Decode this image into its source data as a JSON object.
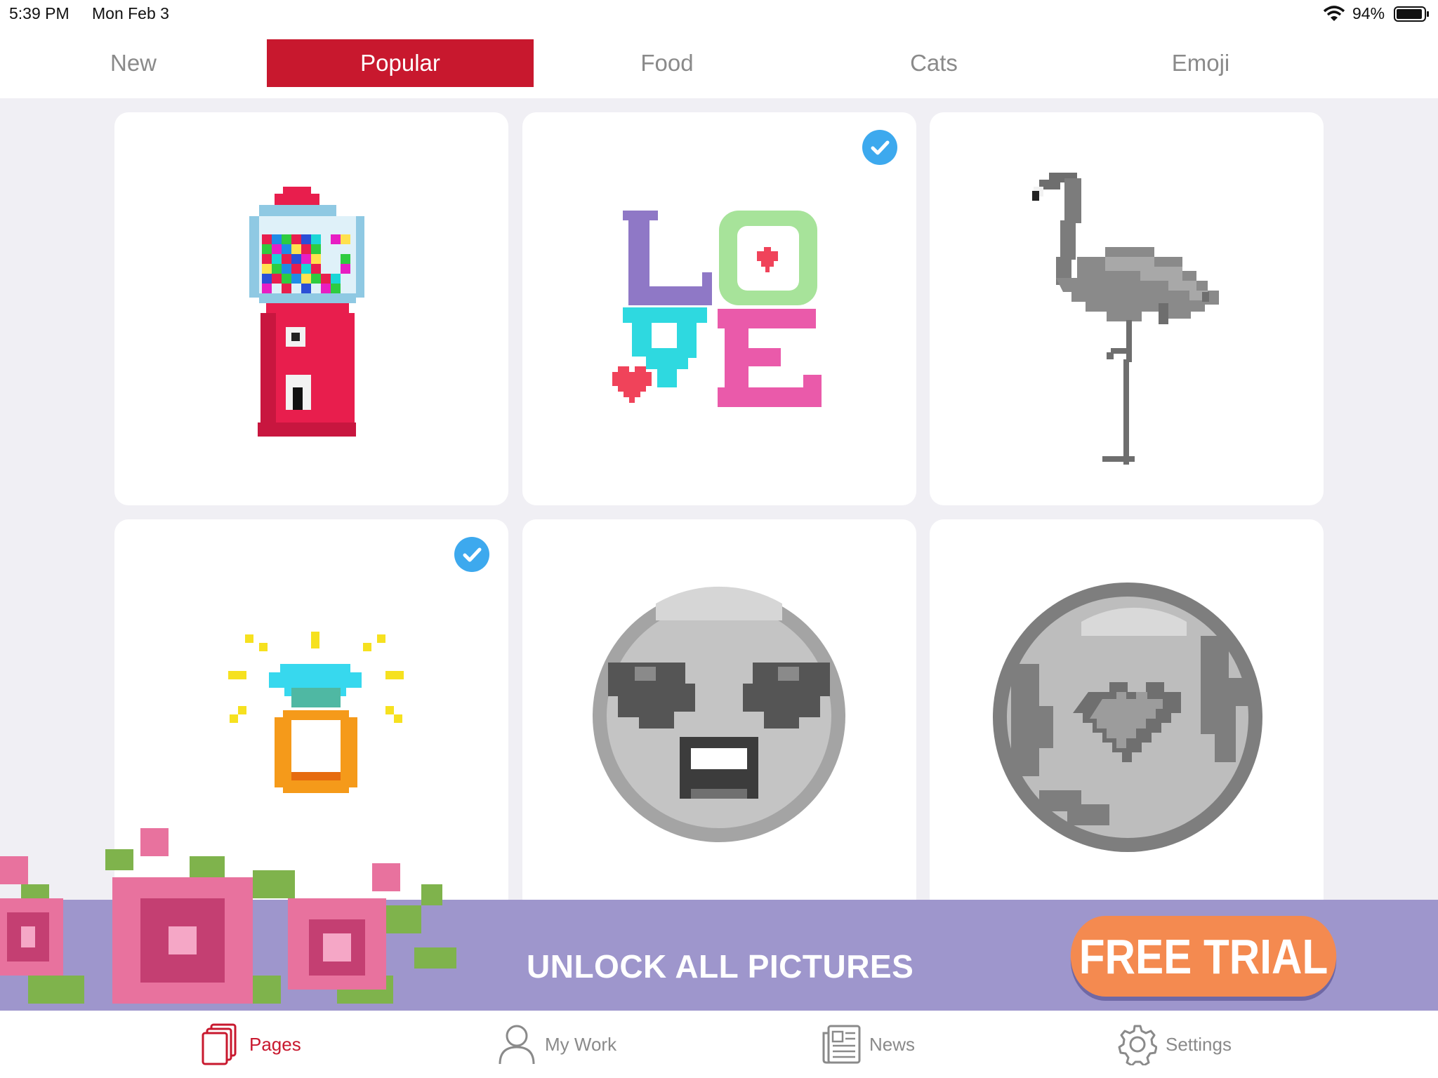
{
  "status_bar": {
    "time": "5:39 PM",
    "date": "Mon Feb 3",
    "battery": "94%"
  },
  "tabs": [
    {
      "label": "New",
      "active": false
    },
    {
      "label": "Popular",
      "active": true
    },
    {
      "label": "Food",
      "active": false
    },
    {
      "label": "Cats",
      "active": false
    },
    {
      "label": "Emoji",
      "active": false
    }
  ],
  "gallery": [
    {
      "name": "gumball-machine",
      "completed": false
    },
    {
      "name": "love-text",
      "completed": true
    },
    {
      "name": "flamingo",
      "completed": false
    },
    {
      "name": "diamond-ring",
      "completed": true
    },
    {
      "name": "star-eyed-emoji",
      "completed": false
    },
    {
      "name": "earth-heart",
      "completed": false
    }
  ],
  "promo": {
    "text": "UNLOCK ALL PICTURES",
    "button": "FREE TRIAL"
  },
  "bottom_nav": [
    {
      "label": "Pages",
      "icon": "pages-icon",
      "active": true
    },
    {
      "label": "My Work",
      "icon": "person-icon",
      "active": false
    },
    {
      "label": "News",
      "icon": "newspaper-icon",
      "active": false
    },
    {
      "label": "Settings",
      "icon": "gear-icon",
      "active": false
    }
  ],
  "colors": {
    "accent": "#c8182e",
    "check": "#3da9ee",
    "promo_bg": "#9e96cc",
    "trial_button": "#f48a50"
  }
}
